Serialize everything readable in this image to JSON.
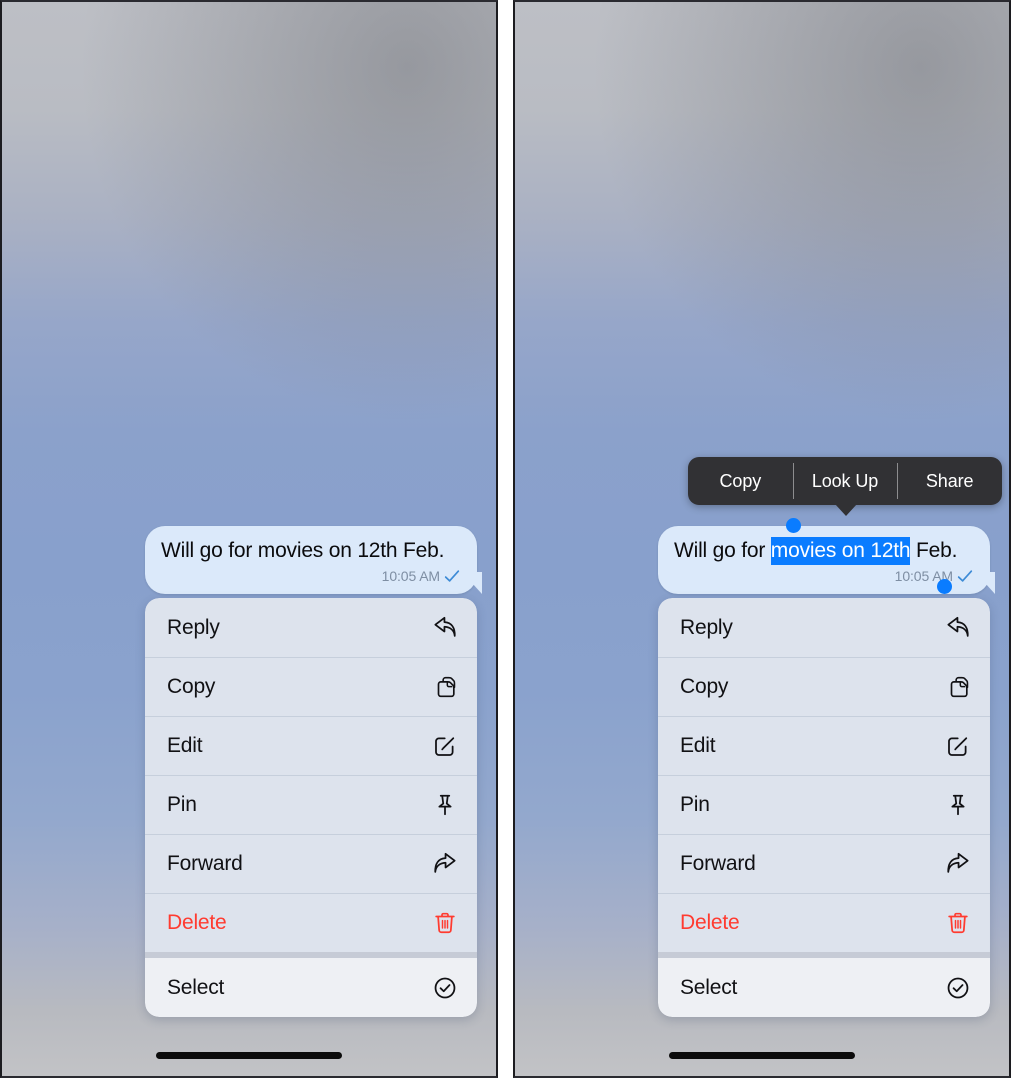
{
  "screen": {
    "wallpaper_top_color": "#bdbfc5",
    "wallpaper_mid_color": "#88a0cc",
    "wallpaper_bottom_color": "#c2c3c6"
  },
  "message": {
    "text_full": "Will go for movies on 12th Feb.",
    "text_before_selection": "Will go for ",
    "text_selected": "movies on 12th",
    "text_after_selection": " Feb.",
    "timestamp": "10:05 AM",
    "status_icon": "check-icon",
    "bubble_color": "#dbe9fa",
    "selection_color": "#0a7cff"
  },
  "selection_popup": {
    "items": [
      {
        "label": "Copy"
      },
      {
        "label": "Look Up"
      },
      {
        "label": "Share"
      }
    ],
    "background_color": "#313134"
  },
  "context_menu": {
    "primary_items": [
      {
        "label": "Reply",
        "icon": "reply-arrow-icon",
        "danger": false
      },
      {
        "label": "Copy",
        "icon": "copy-docs-icon",
        "danger": false
      },
      {
        "label": "Edit",
        "icon": "edit-pencil-icon",
        "danger": false
      },
      {
        "label": "Pin",
        "icon": "pin-icon",
        "danger": false
      },
      {
        "label": "Forward",
        "icon": "forward-arrow-icon",
        "danger": false
      },
      {
        "label": "Delete",
        "icon": "trash-icon",
        "danger": true
      }
    ],
    "secondary_items": [
      {
        "label": "Select",
        "icon": "check-circle-icon",
        "danger": false
      }
    ],
    "danger_color": "#ff3b30"
  },
  "panels": [
    {
      "id": "left",
      "has_selection_popup": false,
      "has_text_selection": false
    },
    {
      "id": "right",
      "has_selection_popup": true,
      "has_text_selection": true
    }
  ]
}
